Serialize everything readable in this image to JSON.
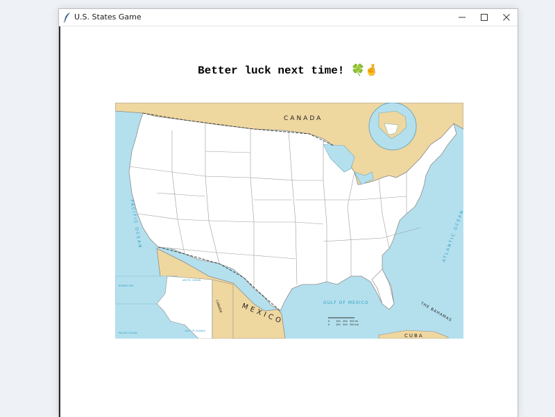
{
  "window": {
    "title": "U.S. States Game",
    "icon": "feather-icon",
    "controls": [
      "minimize-icon",
      "maximize-icon",
      "close-icon"
    ]
  },
  "game": {
    "message": "Better luck next time! 🍀🤞"
  },
  "map": {
    "labels": {
      "canada": "CANADA",
      "mexico": "MEXICO",
      "pacific": "PACIFIC OCEAN",
      "atlantic": "ATLANTIC OCEAN",
      "gulf": "GULF OF MEXICO",
      "bahamas": "THE BAHAMAS",
      "cuba": "CUBA",
      "inset_pacific": "PACIFIC OCEAN",
      "inset_canada": "CANADA",
      "arctic": "ARCTIC OCEAN",
      "bering": "BERING SEA",
      "alaska_gulf": "GULF OF ALASKA"
    },
    "scale": {
      "ticks": [
        "0",
        "100",
        "200",
        "300 mi"
      ],
      "ticks_km": [
        "0",
        "100",
        "200",
        "300 km"
      ]
    },
    "colors": {
      "water": "#b4e0ee",
      "foreign_land": "#efd7a0",
      "us_land": "#ffffff",
      "border": "#8a8a8a",
      "water_text": "#2e9fc4"
    }
  }
}
